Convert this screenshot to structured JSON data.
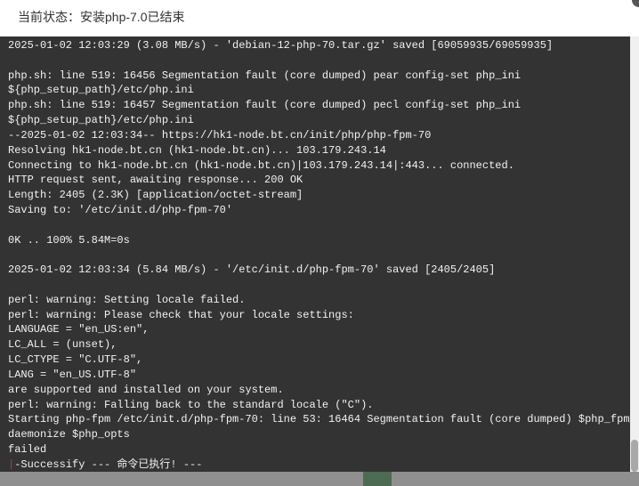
{
  "header": {
    "title": "当前状态：安装php-7.0已结束"
  },
  "terminal": {
    "lines": [
      "2025-01-02 12:03:29 (3.08 MB/s) - 'debian-12-php-70.tar.gz' saved [69059935/69059935]",
      "",
      "php.sh: line 519: 16456 Segmentation fault (core dumped) pear config-set php_ini",
      "${php_setup_path}/etc/php.ini",
      "php.sh: line 519: 16457 Segmentation fault (core dumped) pecl config-set php_ini",
      "${php_setup_path}/etc/php.ini",
      "--2025-01-02 12:03:34-- https://hk1-node.bt.cn/init/php/php-fpm-70",
      "Resolving hk1-node.bt.cn (hk1-node.bt.cn)... 103.179.243.14",
      "Connecting to hk1-node.bt.cn (hk1-node.bt.cn)|103.179.243.14|:443... connected.",
      "HTTP request sent, awaiting response... 200 OK",
      "Length: 2405 (2.3K) [application/octet-stream]",
      "Saving to: '/etc/init.d/php-fpm-70'",
      "",
      "0K .. 100% 5.84M=0s",
      "",
      "2025-01-02 12:03:34 (5.84 MB/s) - '/etc/init.d/php-fpm-70' saved [2405/2405]",
      "",
      "perl: warning: Setting locale failed.",
      "perl: warning: Please check that your locale settings:",
      "LANGUAGE = \"en_US:en\",",
      "LC_ALL = (unset),",
      "LC_CTYPE = \"C.UTF-8\",",
      "LANG = \"en_US.UTF-8\"",
      "are supported and installed on your system.",
      "perl: warning: Falling back to the standard locale (\"C\").",
      "Starting php-fpm /etc/init.d/php-fpm-70: line 53: 16464 Segmentation fault (core dumped) $php_fpm_BIN --",
      "daemonize $php_opts",
      "failed"
    ],
    "cursor": "|",
    "last_line": "-Successify --- 命令已执行! ---"
  },
  "colors": {
    "terminal_bg": "#333333",
    "terminal_text": "#f2f2f2",
    "cursor": "#c0392b"
  }
}
